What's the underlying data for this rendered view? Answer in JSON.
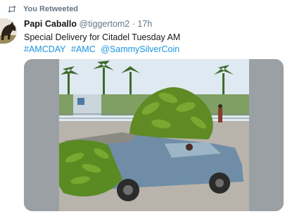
{
  "retweet_context": {
    "icon": "retweet-icon",
    "label": "You Retweeted"
  },
  "tweet": {
    "author": {
      "display_name": "Papi Caballo",
      "handle": "@tiggertom2",
      "avatar": "avatar-horse"
    },
    "separator": "·",
    "timestamp": "17h",
    "text": "Special Delivery for Citadel Tuesday AM",
    "hashtags": [
      "#AMCDAY",
      "#AMC",
      "@SammySilverCoin"
    ]
  },
  "media": {
    "description_icon": "photo",
    "colors": {
      "sky": "#dfe9f1",
      "bananas": "#5f8a24",
      "car": "#6f8da6",
      "road": "#b8b4ac"
    }
  }
}
